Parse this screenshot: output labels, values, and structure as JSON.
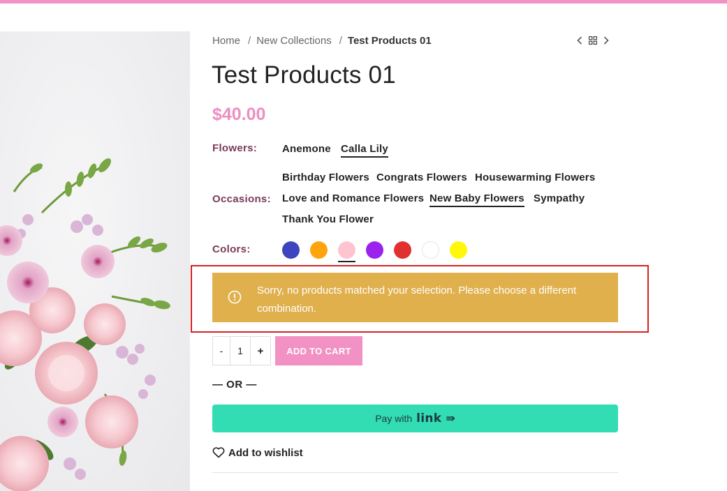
{
  "colors": {
    "top_bar": "#f291c4",
    "price": "#ed8fc1",
    "attr_label": "#7b3b58",
    "notice_bg": "#e0b04d",
    "add_to_cart_bg": "#f291c4",
    "pay_link_bg": "#33ddb3"
  },
  "breadcrumb": {
    "items": [
      "Home",
      "New Collections"
    ],
    "current": "Test Products 01"
  },
  "product": {
    "title": "Test Products 01",
    "price": "$40.00"
  },
  "attributes": {
    "flowers": {
      "label": "Flowers",
      "options": [
        "Anemone",
        "Calla Lily"
      ],
      "selected": "Calla Lily"
    },
    "occasions": {
      "label": "Occasions",
      "options": [
        "Birthday Flowers",
        "Congrats Flowers",
        "Housewarming Flowers",
        "Love and Romance Flowers",
        "New Baby Flowers",
        "Sympathy",
        "Thank You Flower"
      ],
      "selected": "New Baby Flowers"
    },
    "colors": {
      "label": "Colors",
      "swatches": [
        "#3c44bf",
        "#ffa30f",
        "#ffc4cf",
        "#9b21ee",
        "#e0302f",
        "#ffffff",
        "#fff80a"
      ],
      "selected_index": 2
    }
  },
  "notice": {
    "text": "Sorry, no products matched your selection. Please choose a different combination."
  },
  "cart": {
    "minus": "-",
    "quantity": "1",
    "plus": "+",
    "add_label": "ADD TO CART"
  },
  "or_text": "— OR —",
  "pay": {
    "prefix": "Pay with",
    "logo": "link",
    "arrow": "⇛"
  },
  "wishlist": {
    "label": "Add to wishlist"
  }
}
